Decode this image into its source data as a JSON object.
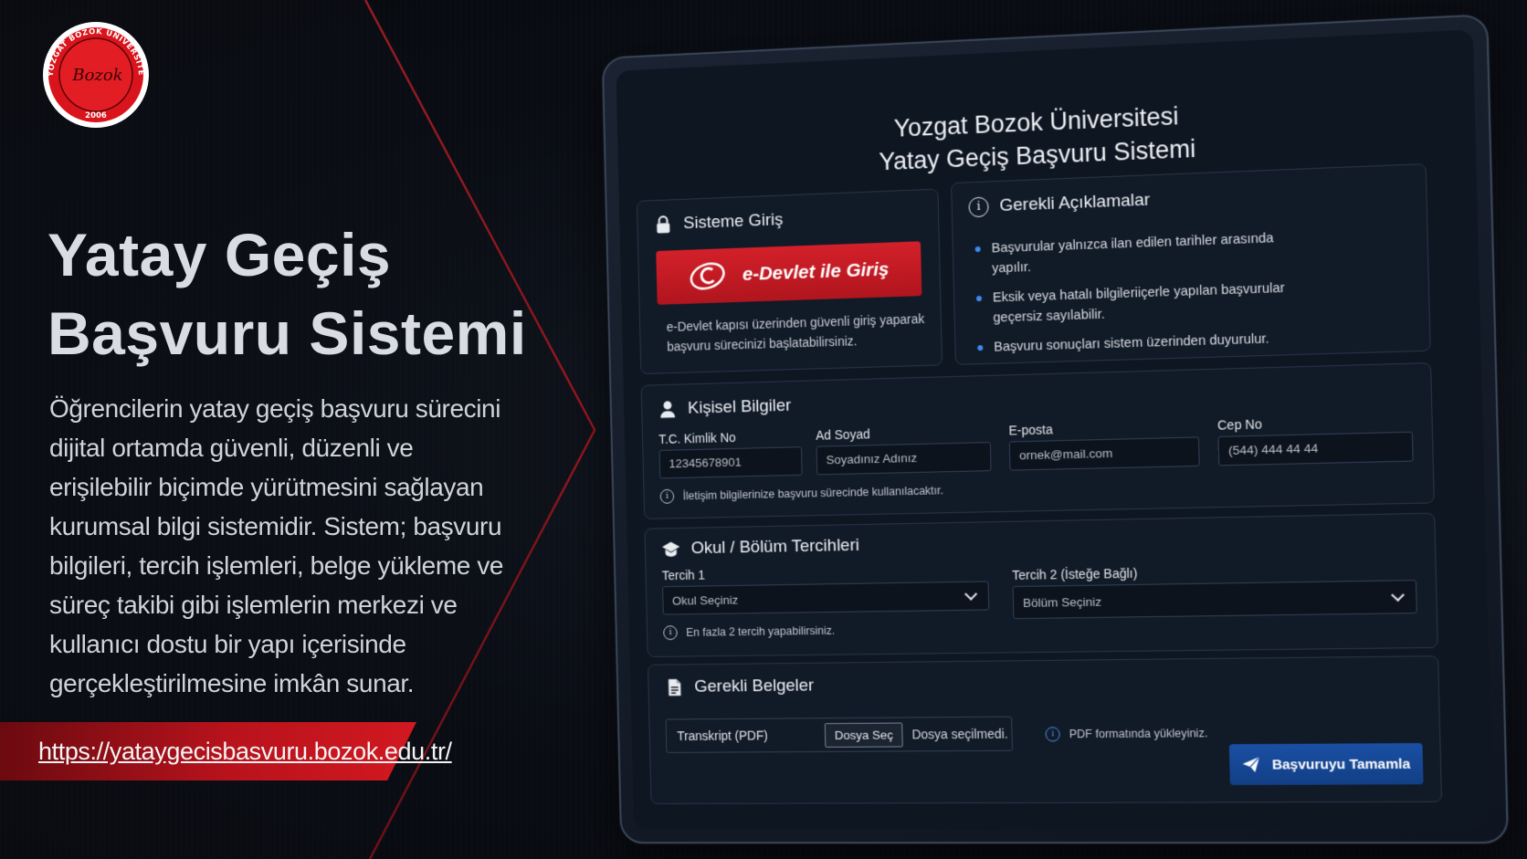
{
  "hero": {
    "title_line1": "Yatay Geçiş",
    "title_line2": "Başvuru Sistemi",
    "description": "Öğrencilerin yatay geçiş başvuru sürecini dijital ortamda güvenli, düzenli ve erişilebilir biçimde yürütmesini sağlayan kurumsal bilgi sistemidir. Sistem; başvuru bilgileri, tercih işlemleri, belge yükleme ve süreç takibi gibi işlemlerin merkezi ve kullanıcı dostu bir yapı içerisinde gerçekleştirilmesine imkân sunar.",
    "url": "https://yataygecisbasvuru.bozok.edu.tr/"
  },
  "logo": {
    "ring_text": "YOZGAT BOZOK ÜNİVERSİTESİ",
    "signature": "Bozok",
    "year": "2006"
  },
  "app": {
    "title_line1": "Yozgat Bozok Üniversitesi",
    "title_line2": "Yatay Geçiş Başvuru Sistemi"
  },
  "login": {
    "heading": "Sisteme Giriş",
    "button_label": "e-Devlet ile Giriş",
    "help_line1": "e-Devlet kapısı üzerinden güvenli giriş yaparak",
    "help_line2": "başvuru sürecinizi başlatabilirsiniz."
  },
  "info": {
    "heading": "Gerekli Açıklamalar",
    "items": [
      "Başvurular yalnızca ilan edilen tarihler arasında yapılır.",
      "Eksik veya hatalı bilgileriiçerle yapılan başvurular geçersiz sayılabilir.",
      "Başvuru sonuçları sistem üzerinden duyurulur."
    ]
  },
  "personal": {
    "heading": "Kişisel Bilgiler",
    "fields": [
      {
        "label": "T.C. Kimlik No",
        "value": "12345678901"
      },
      {
        "label": "Ad Soyad",
        "value": "Soyadınız Adınız"
      },
      {
        "label": "E-posta",
        "value": "ornek@mail.com"
      },
      {
        "label": "Cep No",
        "value": "(544) 444 44 44"
      }
    ],
    "note": "İletişim bilgilerinize başvuru sürecinde kullanılacaktır."
  },
  "preferences": {
    "heading": "Okul / Bölüm Tercihleri",
    "choice1_label": "Tercih 1",
    "choice1_value": "Okul Seçiniz",
    "choice2_label": "Tercih 2 (İsteğe Bağlı)",
    "choice2_value": "Bölüm Seçiniz",
    "note": "En fazla 2 tercih yapabilirsiniz."
  },
  "documents": {
    "heading": "Gerekli Belgeler",
    "file_label": "Transkript (PDF)",
    "file_button": "Dosya Seç",
    "file_status": "Dosya seçilmedi.",
    "note": "PDF formatında yükleyiniz."
  },
  "submit": {
    "label": "Başvuruyu Tamamla"
  },
  "colors": {
    "accent_red": "#d21820",
    "edevlet_red": "#c81b24",
    "submit_blue": "#1a4fa3",
    "bullet_blue": "#3d8bef"
  }
}
